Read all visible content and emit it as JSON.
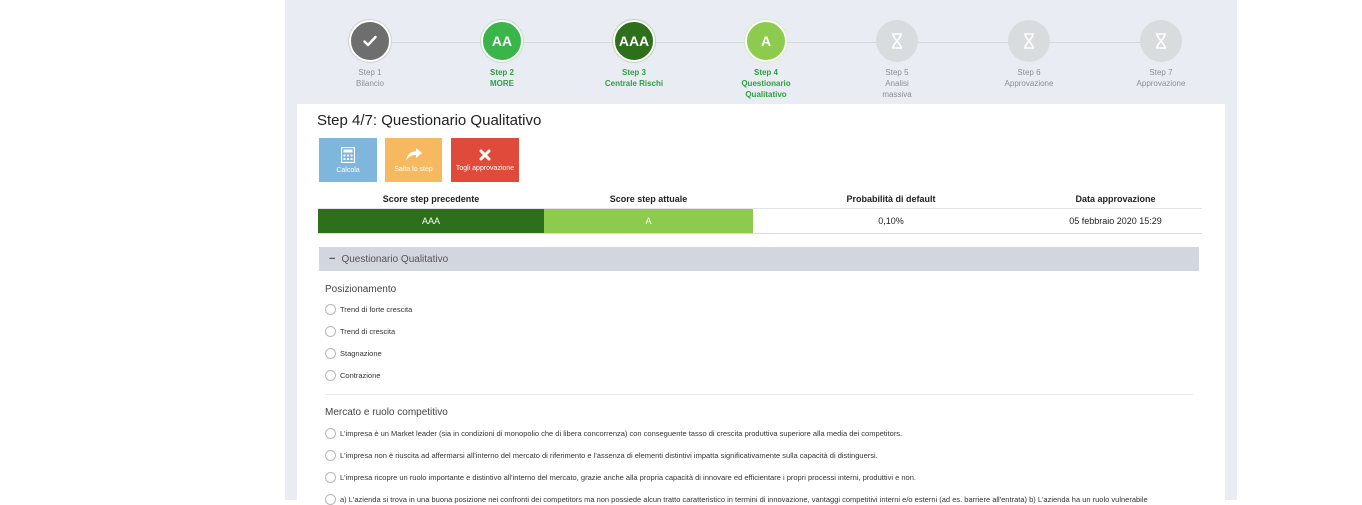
{
  "stepper": {
    "steps": [
      {
        "icon": "check-icon",
        "title": "Step 1",
        "label": "Bilancio",
        "label2": "",
        "state": "done"
      },
      {
        "badge": "AA",
        "title": "Step 2",
        "label": "MORE",
        "label2": "",
        "state": "active"
      },
      {
        "badge": "AAA",
        "title": "Step 3",
        "label": "Centrale Rischi",
        "label2": "",
        "state": "active"
      },
      {
        "badge": "A",
        "title": "Step 4",
        "label": "Questionario",
        "label2": "Qualitativo",
        "state": "active"
      },
      {
        "icon": "hourglass-icon",
        "title": "Step 5",
        "label": "Analisi",
        "label2": "massiva",
        "state": "pending"
      },
      {
        "icon": "hourglass-icon",
        "title": "Step 6",
        "label": "Approvazione",
        "label2": "",
        "state": "pending"
      },
      {
        "icon": "hourglass-icon",
        "title": "Step 7",
        "label": "Approvazione",
        "label2": "",
        "state": "pending"
      }
    ]
  },
  "page": {
    "title": "Step 4/7: Questionario Qualitativo"
  },
  "toolbar": {
    "calc_label": "Calcola",
    "skip_label": "Salta lo step",
    "remove_label": "Togli approvazione"
  },
  "scores": {
    "headers": [
      "Score step precedente",
      "Score step attuale",
      "Probabilità di default",
      "Data approvazione"
    ],
    "previous": "AAA",
    "current": "A",
    "probability": "0,10%",
    "date": "05 febbraio 2020 15:29"
  },
  "colors": {
    "dark_green": "#2e6f1c",
    "light_green": "#8ccb4e",
    "active_green": "#39b54a",
    "danger": "#e04a3a",
    "warning": "#f6b95f",
    "info": "#7fb6db"
  },
  "questionnaire": {
    "section_title": "Questionario Qualitativo",
    "groups": [
      {
        "title": "Posizionamento",
        "options": [
          "Trend di forte crescita",
          "Trend di crescita",
          "Stagnazione",
          "Contrazione"
        ]
      },
      {
        "title": "Mercato e ruolo competitivo",
        "options": [
          "L'impresa è un Market leader (sia in condizioni di monopolio che di libera concorrenza) con conseguente tasso di crescita produttiva superiore alla media dei competitors.",
          "L'impresa non è riuscita ad affermarsi all'interno del mercato di riferimento e l'assenza di elementi distintivi impatta significativamente sulla capacità  di distinguersi.",
          "L'impresa ricopre un ruolo importante e distintivo all'interno del mercato, grazie anche alla propria capacità  di innovare ed efficientare i propri processi interni, produttivi e non.",
          "a) L'azienda si trova in una buona posizione nei confronti dei competitors ma non possiede alcun tratto caratteristico in termini di innovazione, vantaggi competitivi interni e/o esterni (ad es. barriere all'entrata) b) L'azienda ha un ruolo vulnerabile"
        ]
      }
    ]
  }
}
